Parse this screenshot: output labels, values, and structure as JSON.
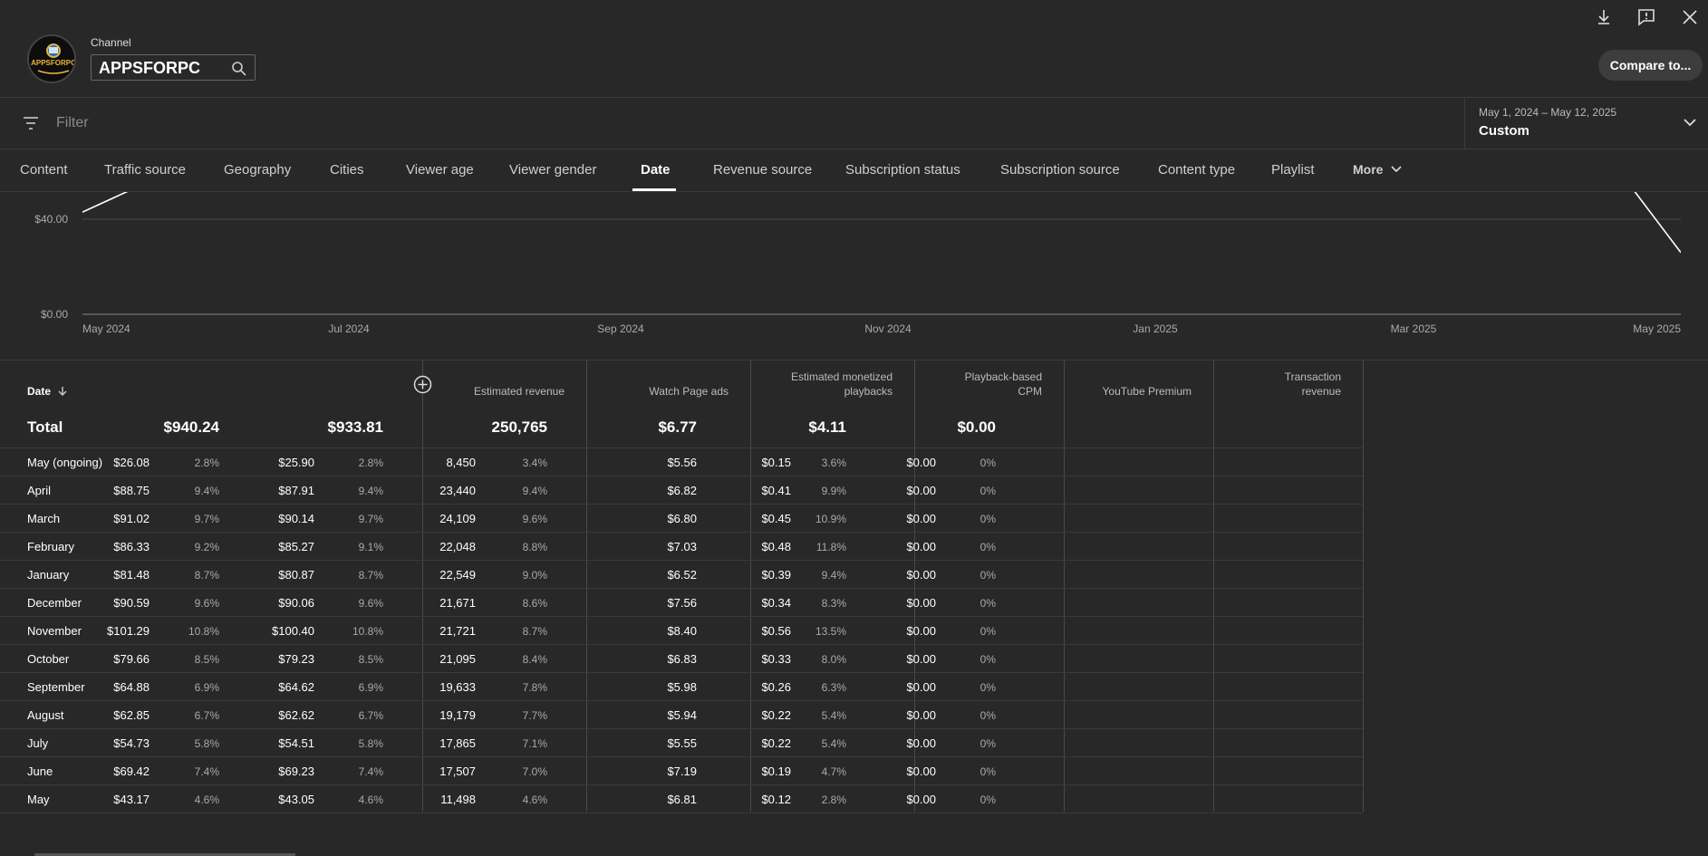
{
  "header": {
    "channel_label": "Channel",
    "channel_name": "APPSFORPC",
    "avatar_text": "APPSFORPC",
    "compare_label": "Compare to..."
  },
  "filter": {
    "placeholder": "Filter"
  },
  "date_range": {
    "range": "May 1, 2024 – May 12, 2025",
    "preset": "Custom"
  },
  "tabs": [
    {
      "label": "Content"
    },
    {
      "label": "Traffic source"
    },
    {
      "label": "Geography"
    },
    {
      "label": "Cities"
    },
    {
      "label": "Viewer age"
    },
    {
      "label": "Viewer gender"
    },
    {
      "label": "Date"
    },
    {
      "label": "Revenue source"
    },
    {
      "label": "Subscription status"
    },
    {
      "label": "Subscription source"
    },
    {
      "label": "Content type"
    },
    {
      "label": "Playlist"
    },
    {
      "label": "More"
    }
  ],
  "chart_data": {
    "type": "line",
    "y_ticks": [
      "$40.00",
      "$0.00"
    ],
    "x_ticks": [
      "May 2024",
      "Jul 2024",
      "Sep 2024",
      "Nov 2024",
      "Jan 2025",
      "Mar 2025",
      "May 2025"
    ],
    "ylim": [
      0,
      60
    ],
    "grid": true,
    "series": [
      {
        "x": [
          "2024-05-01",
          "2024-05-12"
        ],
        "y": [
          43,
          52
        ]
      },
      {
        "x": [
          "2025-05-01",
          "2025-05-12"
        ],
        "y": [
          52,
          26
        ]
      }
    ]
  },
  "table": {
    "date_header": "Date",
    "columns": [
      {
        "label_lines": [
          "Estimated revenue"
        ]
      },
      {
        "label_lines": [
          "Watch Page ads"
        ]
      },
      {
        "label_lines": [
          "Estimated monetized",
          "playbacks"
        ]
      },
      {
        "label_lines": [
          "Playback-based",
          "CPM"
        ]
      },
      {
        "label_lines": [
          "YouTube Premium"
        ]
      },
      {
        "label_lines": [
          "Transaction",
          "revenue"
        ]
      }
    ],
    "total": {
      "label": "Total",
      "values": [
        "$940.24",
        "$933.81",
        "250,765",
        "$6.77",
        "$4.11",
        "$0.00"
      ]
    },
    "rows": [
      {
        "label": "May (ongoing)",
        "values": [
          [
            "$26.08",
            "2.8%"
          ],
          [
            "$25.90",
            "2.8%"
          ],
          [
            "8,450",
            "3.4%"
          ],
          [
            "$5.56",
            ""
          ],
          [
            "$0.15",
            "3.6%"
          ],
          [
            "$0.00",
            "0%"
          ]
        ]
      },
      {
        "label": "April",
        "values": [
          [
            "$88.75",
            "9.4%"
          ],
          [
            "$87.91",
            "9.4%"
          ],
          [
            "23,440",
            "9.4%"
          ],
          [
            "$6.82",
            ""
          ],
          [
            "$0.41",
            "9.9%"
          ],
          [
            "$0.00",
            "0%"
          ]
        ]
      },
      {
        "label": "March",
        "values": [
          [
            "$91.02",
            "9.7%"
          ],
          [
            "$90.14",
            "9.7%"
          ],
          [
            "24,109",
            "9.6%"
          ],
          [
            "$6.80",
            ""
          ],
          [
            "$0.45",
            "10.9%"
          ],
          [
            "$0.00",
            "0%"
          ]
        ]
      },
      {
        "label": "February",
        "values": [
          [
            "$86.33",
            "9.2%"
          ],
          [
            "$85.27",
            "9.1%"
          ],
          [
            "22,048",
            "8.8%"
          ],
          [
            "$7.03",
            ""
          ],
          [
            "$0.48",
            "11.8%"
          ],
          [
            "$0.00",
            "0%"
          ]
        ]
      },
      {
        "label": "January",
        "values": [
          [
            "$81.48",
            "8.7%"
          ],
          [
            "$80.87",
            "8.7%"
          ],
          [
            "22,549",
            "9.0%"
          ],
          [
            "$6.52",
            ""
          ],
          [
            "$0.39",
            "9.4%"
          ],
          [
            "$0.00",
            "0%"
          ]
        ]
      },
      {
        "label": "December",
        "values": [
          [
            "$90.59",
            "9.6%"
          ],
          [
            "$90.06",
            "9.6%"
          ],
          [
            "21,671",
            "8.6%"
          ],
          [
            "$7.56",
            ""
          ],
          [
            "$0.34",
            "8.3%"
          ],
          [
            "$0.00",
            "0%"
          ]
        ]
      },
      {
        "label": "November",
        "values": [
          [
            "$101.29",
            "10.8%"
          ],
          [
            "$100.40",
            "10.8%"
          ],
          [
            "21,721",
            "8.7%"
          ],
          [
            "$8.40",
            ""
          ],
          [
            "$0.56",
            "13.5%"
          ],
          [
            "$0.00",
            "0%"
          ]
        ]
      },
      {
        "label": "October",
        "values": [
          [
            "$79.66",
            "8.5%"
          ],
          [
            "$79.23",
            "8.5%"
          ],
          [
            "21,095",
            "8.4%"
          ],
          [
            "$6.83",
            ""
          ],
          [
            "$0.33",
            "8.0%"
          ],
          [
            "$0.00",
            "0%"
          ]
        ]
      },
      {
        "label": "September",
        "values": [
          [
            "$64.88",
            "6.9%"
          ],
          [
            "$64.62",
            "6.9%"
          ],
          [
            "19,633",
            "7.8%"
          ],
          [
            "$5.98",
            ""
          ],
          [
            "$0.26",
            "6.3%"
          ],
          [
            "$0.00",
            "0%"
          ]
        ]
      },
      {
        "label": "August",
        "values": [
          [
            "$62.85",
            "6.7%"
          ],
          [
            "$62.62",
            "6.7%"
          ],
          [
            "19,179",
            "7.7%"
          ],
          [
            "$5.94",
            ""
          ],
          [
            "$0.22",
            "5.4%"
          ],
          [
            "$0.00",
            "0%"
          ]
        ]
      },
      {
        "label": "July",
        "values": [
          [
            "$54.73",
            "5.8%"
          ],
          [
            "$54.51",
            "5.8%"
          ],
          [
            "17,865",
            "7.1%"
          ],
          [
            "$5.55",
            ""
          ],
          [
            "$0.22",
            "5.4%"
          ],
          [
            "$0.00",
            "0%"
          ]
        ]
      },
      {
        "label": "June",
        "values": [
          [
            "$69.42",
            "7.4%"
          ],
          [
            "$69.23",
            "7.4%"
          ],
          [
            "17,507",
            "7.0%"
          ],
          [
            "$7.19",
            ""
          ],
          [
            "$0.19",
            "4.7%"
          ],
          [
            "$0.00",
            "0%"
          ]
        ]
      },
      {
        "label": "May",
        "values": [
          [
            "$43.17",
            "4.6%"
          ],
          [
            "$43.05",
            "4.6%"
          ],
          [
            "11,498",
            "4.6%"
          ],
          [
            "$6.81",
            ""
          ],
          [
            "$0.12",
            "2.8%"
          ],
          [
            "$0.00",
            "0%"
          ]
        ]
      }
    ]
  }
}
